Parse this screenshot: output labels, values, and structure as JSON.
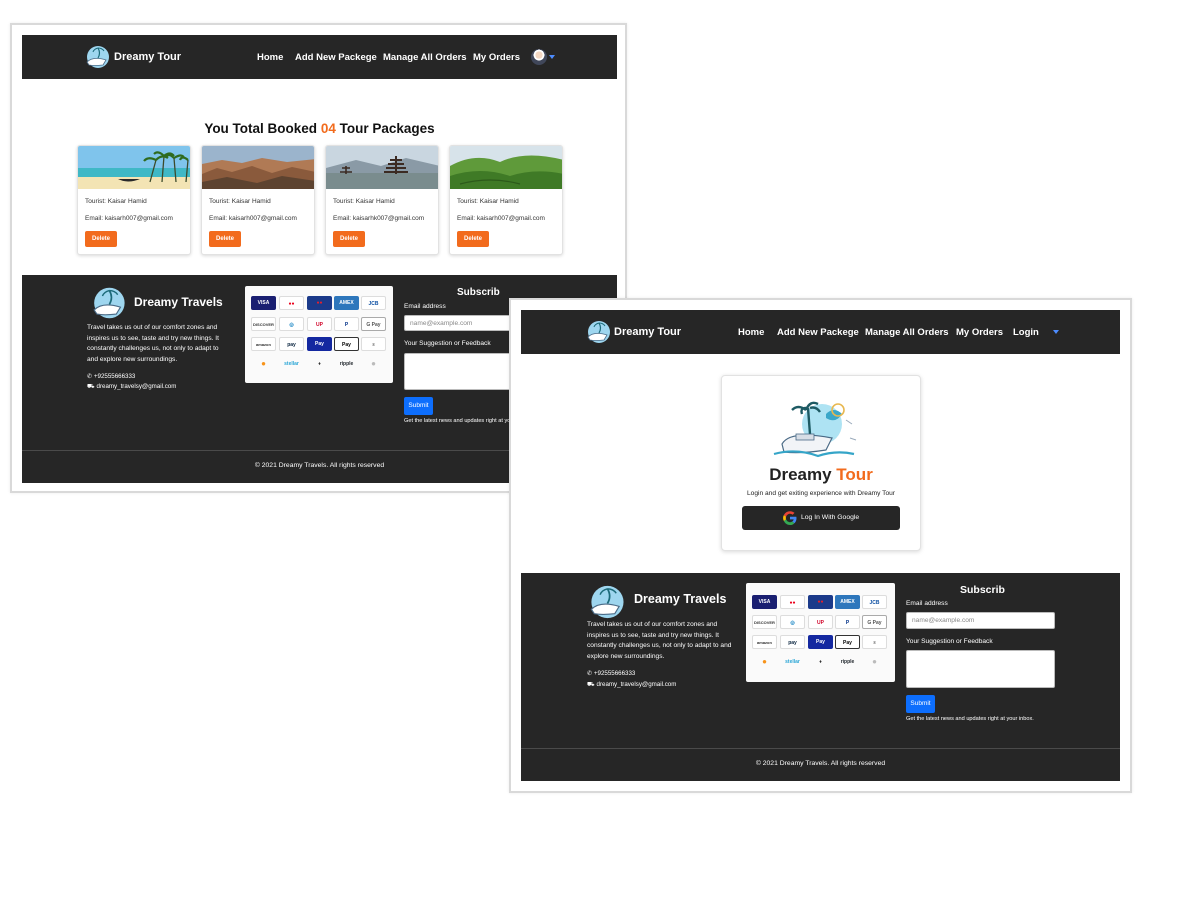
{
  "brand": {
    "name": "Dreamy Tour"
  },
  "nav": {
    "home": "Home",
    "add_package": "Add New Packege",
    "manage_orders": "Manage All Orders",
    "my_orders": "My Orders",
    "login": "Login"
  },
  "orders_page": {
    "heading_prefix": "You Total Booked",
    "count": "04",
    "heading_suffix": "Tour Packages",
    "cards": [
      {
        "tourist": "Tourist: Kaisar Hamid",
        "email": "Email: kaisarh007@gmail.com",
        "delete_label": "Delete"
      },
      {
        "tourist": "Tourist: Kaisar Hamid",
        "email": "Email: kaisarh007@gmail.com",
        "delete_label": "Delete"
      },
      {
        "tourist": "Tourist: Kaisar Hamid",
        "email": "Email: kaisarhk007@gmail.com",
        "delete_label": "Delete"
      },
      {
        "tourist": "Tourist: Kaisar Hamid",
        "email": "Email: kaisarh007@gmail.com",
        "delete_label": "Delete"
      }
    ]
  },
  "login_page": {
    "title_main": "Dreamy",
    "title_accent": "Tour",
    "subtitle": "Login and get exiting experience with Dreamy Tour",
    "google_button": "Log In With Google"
  },
  "footer": {
    "brand": "Dreamy Travels",
    "description": "Travel takes us out of our comfort zones and inspires us to see, taste and try new things. It constantly challenges us, not only to adapt to and explore new surroundings.",
    "phone": "+92555666333",
    "email": "dreamy_travelsy@gmail.com",
    "payments": [
      "VISA",
      "mastercard",
      "maestro",
      "AMEX",
      "JCB",
      "DISCOVER",
      "diners",
      "UnionPay",
      "PayPal",
      "G Pay",
      "amazon pay",
      "pay",
      "Samsung Pay",
      "Apple Pay",
      "bitcoin",
      "stellar",
      "ethereum",
      "ripple",
      "litecoin"
    ],
    "subscribe_title": "Subscrib",
    "email_label": "Email address",
    "email_placeholder": "name@example.com",
    "feedback_label": "Your Suggestion or Feedback",
    "submit_label": "Submit",
    "note": "Get the latest news and updates right at your inbox.",
    "copyright": "© 2021 Dreamy Travels. All rights reserved"
  },
  "colors": {
    "accent": "#f26b1d",
    "navbar": "#262626",
    "submit": "#0d6efd"
  }
}
